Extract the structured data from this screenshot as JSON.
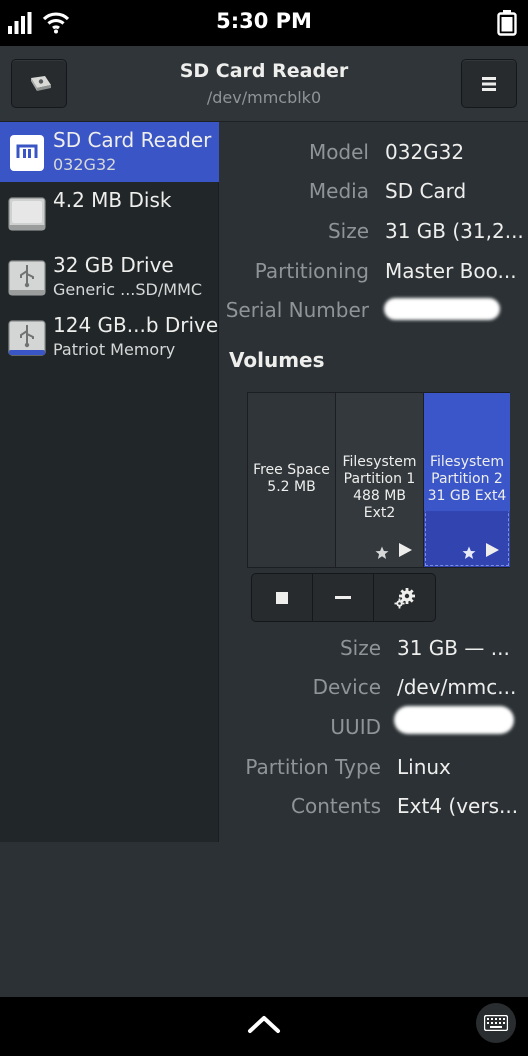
{
  "status_bar": {
    "time": "5:30 PM"
  },
  "header": {
    "title": "SD Card Reader",
    "subtitle": "/dev/mmcblk0"
  },
  "drives": [
    {
      "name": "SD Card Reader",
      "sub": "032G32",
      "selected": true,
      "icon": "sd-card-icon"
    },
    {
      "name": "4.2 MB Disk",
      "sub": "",
      "selected": false,
      "icon": "hard-disk-icon"
    },
    {
      "name": "32 GB Drive",
      "sub": "Generic ...SD/MMC",
      "selected": false,
      "icon": "usb-drive-icon"
    },
    {
      "name": "124 GB...b Drive",
      "sub": "Patriot Memory",
      "selected": false,
      "icon": "usb-drive-icon"
    }
  ],
  "drive_details": {
    "model_label": "Model",
    "model_value": "032G32",
    "media_label": "Media",
    "media_value": "SD Card",
    "size_label": "Size",
    "size_value": "31 GB (31,2...",
    "partitioning_label": "Partitioning",
    "partitioning_value": "Master Boo...",
    "serial_label": "Serial Number"
  },
  "volumes": {
    "heading": "Volumes",
    "segments": [
      {
        "line1": "Free Space",
        "line2": "5.2 MB",
        "line3": ""
      },
      {
        "line1": "Filesystem",
        "line2": "Partition 1",
        "line3": "488 MB Ext2"
      },
      {
        "line1": "Filesystem",
        "line2": "Partition 2",
        "line3": "31 GB Ext4"
      }
    ]
  },
  "volume_details": {
    "size_label": "Size",
    "size_value": "31 GB — ...",
    "device_label": "Device",
    "device_value": "/dev/mmc...",
    "uuid_label": "UUID",
    "partition_type_label": "Partition Type",
    "partition_type_value": "Linux",
    "contents_label": "Contents",
    "contents_value": "Ext4 (vers..."
  },
  "colors": {
    "accent": "#3a55c5",
    "background": "#2b3135",
    "sidebar": "#212629"
  }
}
